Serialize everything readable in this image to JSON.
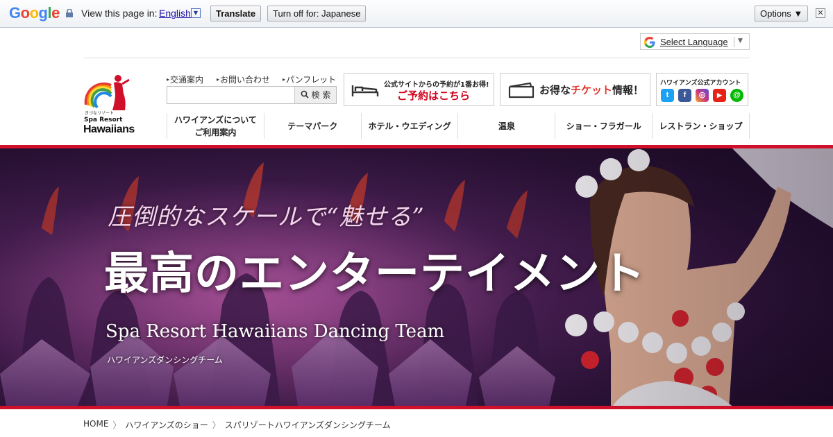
{
  "translate_bar": {
    "logo": "Google",
    "view_in": "View this page in:",
    "language": "English",
    "translate_button": "Translate",
    "turn_off_button": "Turn off for: Japanese",
    "options_button": "Options ▼",
    "close": "✕"
  },
  "select_language": {
    "label": "Select Language",
    "arrow": "▼"
  },
  "logo": {
    "tagline": "きづなリゾート",
    "sub": "Spa Resort",
    "main": "Hawaiians"
  },
  "sublinks": [
    "交通案内",
    "お問い合わせ",
    "パンフレット"
  ],
  "search": {
    "button": "検 索"
  },
  "banners": {
    "reserve_line1": "公式サイトからの予約が1番お得!",
    "reserve_line2": "ご予約はこちら",
    "ticket_prefix": "お得な",
    "ticket_highlight": "チケット",
    "ticket_suffix": "情報！",
    "sns_title": "ハワイアンズ公式アカウント"
  },
  "sns": [
    {
      "name": "twitter-icon",
      "glyph": "t",
      "color": "#1da1f2"
    },
    {
      "name": "facebook-icon",
      "glyph": "f",
      "color": "#3b5998"
    },
    {
      "name": "instagram-icon",
      "glyph": "◎",
      "color": "#c13584"
    },
    {
      "name": "youtube-icon",
      "glyph": "▶",
      "color": "#e62117"
    },
    {
      "name": "line-icon",
      "glyph": "@",
      "color": "#00b900"
    }
  ],
  "nav": [
    "ハワイアンズについて\nご利用案内",
    "テーマパーク",
    "ホテル・ウエディング",
    "温泉",
    "ショー・フラガール",
    "レストラン・ショップ"
  ],
  "hero": {
    "copy1": "圧倒的なスケールで“魅せる”",
    "copy2": "最高のエンターテイメント",
    "copy3": "Spa Resort Hawaiians Dancing Team",
    "copy4": "ハワイアンズダンシングチーム"
  },
  "breadcrumb": [
    "HOME",
    "ハワイアンズのショー",
    "スパリゾートハワイアンズダンシングチーム"
  ],
  "colors": {
    "accent_red": "#d0102a",
    "link_blue": "#1a0dab"
  }
}
